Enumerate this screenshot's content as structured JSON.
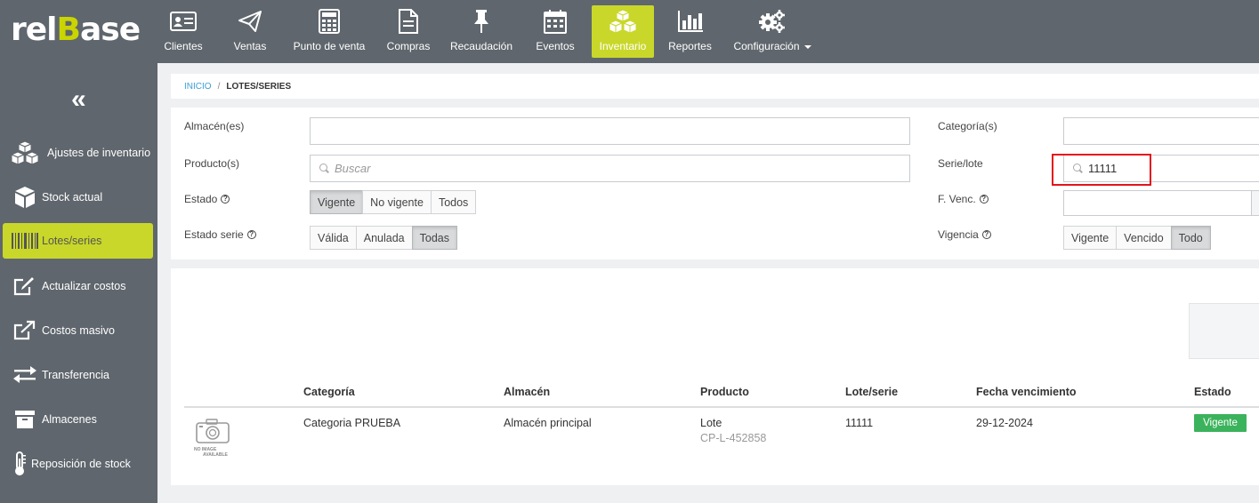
{
  "app": {
    "logo_prefix": "rel",
    "logo_b": "B",
    "logo_suffix": "ase"
  },
  "nav": [
    {
      "label": "Clientes",
      "icon": "address-card-icon"
    },
    {
      "label": "Ventas",
      "icon": "paper-plane-icon"
    },
    {
      "label": "Punto de venta",
      "icon": "calculator-icon"
    },
    {
      "label": "Compras",
      "icon": "document-icon"
    },
    {
      "label": "Recaudación",
      "icon": "pin-icon"
    },
    {
      "label": "Eventos",
      "icon": "calendar-icon"
    },
    {
      "label": "Inventario",
      "icon": "cubes-icon",
      "active": true
    },
    {
      "label": "Reportes",
      "icon": "bar-chart-icon"
    },
    {
      "label": "Configuración",
      "icon": "gears-icon"
    }
  ],
  "sidebar": {
    "collapse_label": "«",
    "items": [
      {
        "label": "Ajustes de inventario",
        "icon": "cubes-icon"
      },
      {
        "label": "Stock actual",
        "icon": "box-icon"
      },
      {
        "label": "Lotes/series",
        "icon": "barcode-icon",
        "active": true
      },
      {
        "label": "Actualizar costos",
        "icon": "edit-icon"
      },
      {
        "label": "Costos masivo",
        "icon": "external-link-icon"
      },
      {
        "label": "Transferencia",
        "icon": "exchange-icon"
      },
      {
        "label": "Almacenes",
        "icon": "archive-icon"
      },
      {
        "label": "Reposición de stock",
        "icon": "thermometer-icon"
      }
    ]
  },
  "breadcrumb": {
    "home": "INICIO",
    "separator": "/",
    "current": "LOTES/SERIES"
  },
  "filters": {
    "almacenes_label": "Almacén(es)",
    "productos_label": "Producto(s)",
    "productos_placeholder": "Buscar",
    "estado_label": "Estado",
    "estado_options": [
      "Vigente",
      "No vigente",
      "Todos"
    ],
    "estado_selected": "Vigente",
    "estado_serie_label": "Estado serie",
    "estado_serie_options": [
      "Válida",
      "Anulada",
      "Todas"
    ],
    "estado_serie_selected": "Todas",
    "categorias_label": "Categoría(s)",
    "serie_lote_label": "Serie/lote",
    "serie_lote_value": "11111",
    "fvenc_label": "F. Venc.",
    "vigencia_label": "Vigencia",
    "vigencia_options": [
      "Vigente",
      "Vencido",
      "Todo"
    ],
    "vigencia_selected": "Todo",
    "help_glyph": "?"
  },
  "table": {
    "headers": [
      "Categoría",
      "Almacén",
      "Producto",
      "Lote/serie",
      "Fecha vencimiento",
      "Estado"
    ],
    "rows": [
      {
        "image_text": [
          "NO IMAGE",
          "AVAILABLE"
        ],
        "categoria": "Categoria PRUEBA",
        "almacen": "Almacén principal",
        "producto": "Lote",
        "producto_code": "CP-L-452858",
        "lote_serie": "11111",
        "fecha_vencimiento": "29-12-2024",
        "estado": "Vigente"
      }
    ]
  },
  "colors": {
    "topbar": "#5f666d",
    "accent": "#c9d72a",
    "status_green": "#3bb35c",
    "highlight_red": "#e3141c"
  }
}
